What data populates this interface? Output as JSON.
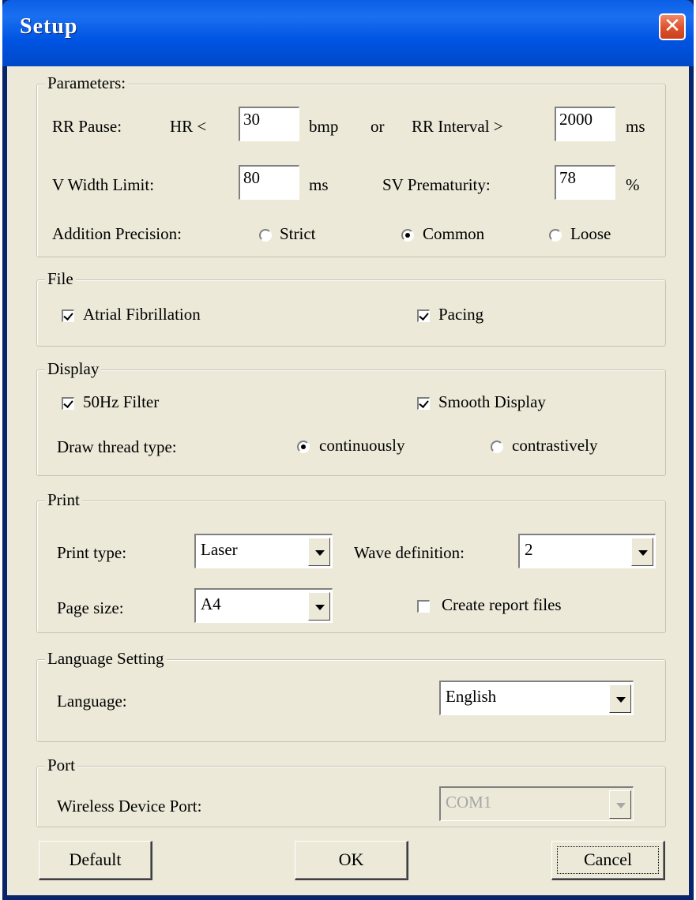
{
  "window": {
    "title": "Setup",
    "close_glyph": "✕"
  },
  "parameters": {
    "legend": "Parameters:",
    "rr_pause_label": "RR Pause:",
    "hr_label": "HR <",
    "hr_value": "30",
    "bmp_label": "bmp",
    "or_label": "or",
    "rr_interval_label": "RR Interval >",
    "rr_interval_value": "2000",
    "ms_label": "ms",
    "v_width_label": "V Width Limit:",
    "v_width_value": "80",
    "v_width_unit": "ms",
    "sv_prem_label": "SV Prematurity:",
    "sv_prem_value": "78",
    "sv_prem_unit": "%",
    "addition_precision_label": "Addition Precision:",
    "precision_options": [
      {
        "label": "Strict",
        "selected": false
      },
      {
        "label": "Common",
        "selected": true
      },
      {
        "label": "Loose",
        "selected": false
      }
    ]
  },
  "file": {
    "legend": "File",
    "atrial_fibrillation": {
      "label": "Atrial Fibrillation",
      "checked": true
    },
    "pacing": {
      "label": "Pacing",
      "checked": true
    }
  },
  "display": {
    "legend": "Display",
    "filter_50hz": {
      "label": "50Hz Filter",
      "checked": true
    },
    "smooth_display": {
      "label": "Smooth Display",
      "checked": true
    },
    "draw_thread_label": "Draw thread type:",
    "draw_options": [
      {
        "label": "continuously",
        "selected": true
      },
      {
        "label": "contrastively",
        "selected": false
      }
    ]
  },
  "print": {
    "legend": "Print",
    "print_type_label": "Print type:",
    "print_type_value": "Laser",
    "wave_definition_label": "Wave definition:",
    "wave_definition_value": "2",
    "page_size_label": "Page size:",
    "page_size_value": "A4",
    "create_report": {
      "label": "Create report files",
      "checked": false
    }
  },
  "language_setting": {
    "legend": "Language Setting",
    "language_label": "Language:",
    "language_value": "English"
  },
  "port": {
    "legend": "Port",
    "wireless_port_label": "Wireless Device Port:",
    "wireless_port_value": "COM1",
    "disabled": true
  },
  "buttons": {
    "default_label": "Default",
    "ok_label": "OK",
    "cancel_label": "Cancel"
  }
}
